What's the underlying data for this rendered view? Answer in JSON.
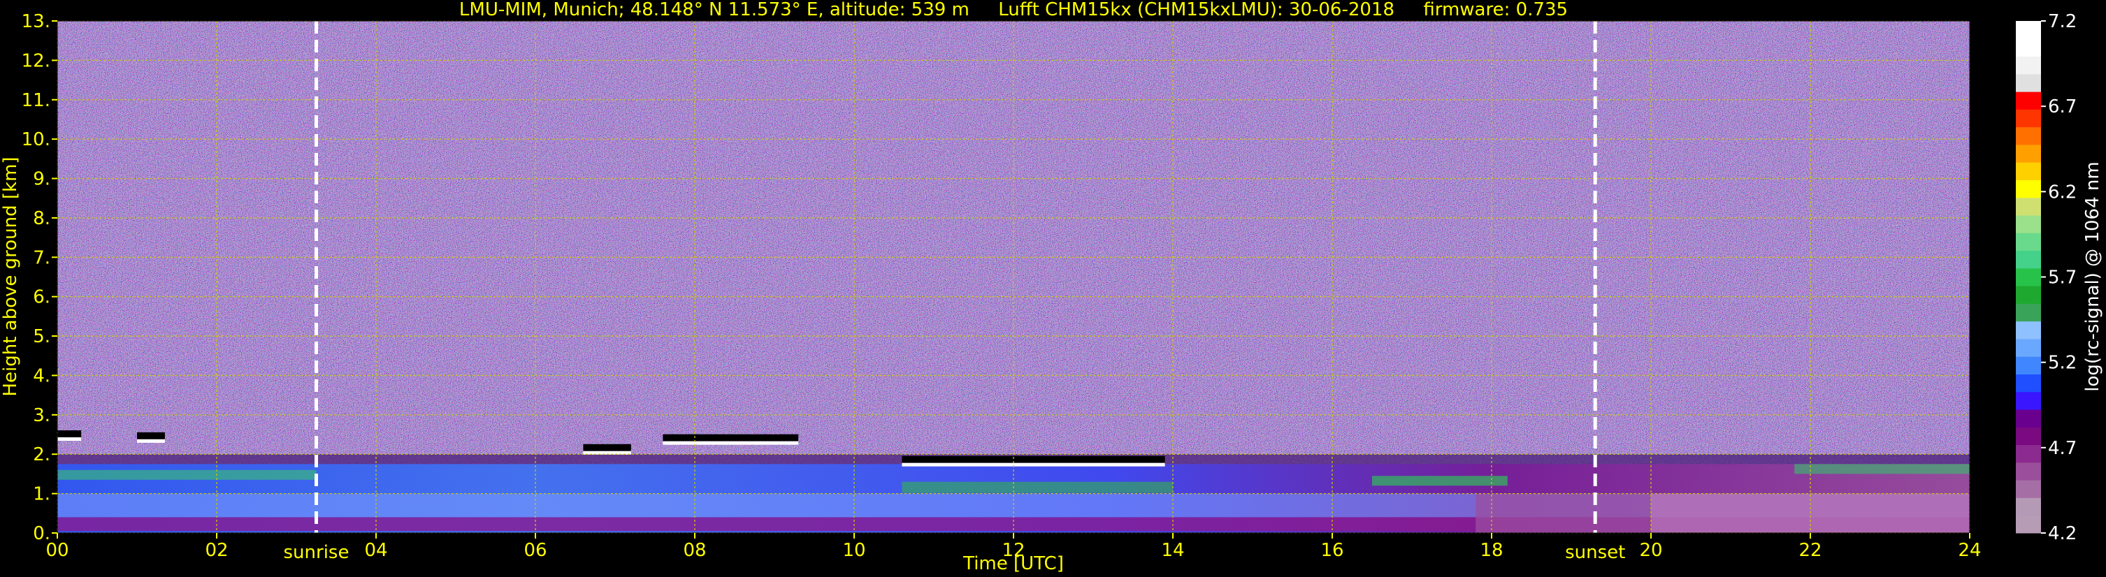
{
  "chart_data": {
    "type": "heatmap",
    "title": "LMU-MIM, Munich; 48.148° N 11.573° E, altitude: 539 m     Lufft CHM15kx (CHM15kxLMU): 30-06-2018     firmware: 0.735",
    "xlabel": "Time [UTC]",
    "ylabel": "Height above ground [km]",
    "xlim": [
      0,
      24
    ],
    "ylim": [
      0,
      13
    ],
    "x_ticks": [
      "00",
      "02",
      "04",
      "06",
      "08",
      "10",
      "12",
      "14",
      "16",
      "18",
      "20",
      "22",
      "24"
    ],
    "y_ticks": [
      "0.",
      "1.",
      "2.",
      "3.",
      "4.",
      "5.",
      "6.",
      "7.",
      "8.",
      "9.",
      "10.",
      "11.",
      "12.",
      "13."
    ],
    "grid": true,
    "markers": [
      {
        "label": "sunrise",
        "time": 3.25
      },
      {
        "label": "sunset",
        "time": 19.3
      }
    ],
    "colorbar": {
      "label": "log(rc-signal) @ 1064 nm",
      "range": [
        4.2,
        7.2
      ],
      "ticks": [
        "4.2",
        "4.7",
        "5.2",
        "5.7",
        "6.2",
        "6.7",
        "7.2"
      ],
      "colors": [
        "#b79cb6",
        "#b59ab6",
        "#a56fa5",
        "#9a4f9a",
        "#8b2b8f",
        "#7a0a80",
        "#6a008e",
        "#3a16ff",
        "#1f4fff",
        "#3f86ff",
        "#6aa8ff",
        "#8fc0ff",
        "#3aa35a",
        "#1ea82f",
        "#27c24a",
        "#44d18a",
        "#69d98c",
        "#9be08a",
        "#d0e070",
        "#ffff00",
        "#ffd000",
        "#ffa000",
        "#ff7000",
        "#ff3500",
        "#ff0000",
        "#e0e0e0",
        "#f2f2f2",
        "#ffffff",
        "#ffffff"
      ]
    },
    "cloud_layers": [
      {
        "start": 0.0,
        "end": 0.3,
        "height": 2.5
      },
      {
        "start": 1.0,
        "end": 1.35,
        "height": 2.45
      },
      {
        "start": 6.6,
        "end": 7.2,
        "height": 2.15
      },
      {
        "start": 7.6,
        "end": 9.3,
        "height": 2.4
      },
      {
        "start": 10.6,
        "end": 13.9,
        "height": 1.85
      }
    ]
  }
}
